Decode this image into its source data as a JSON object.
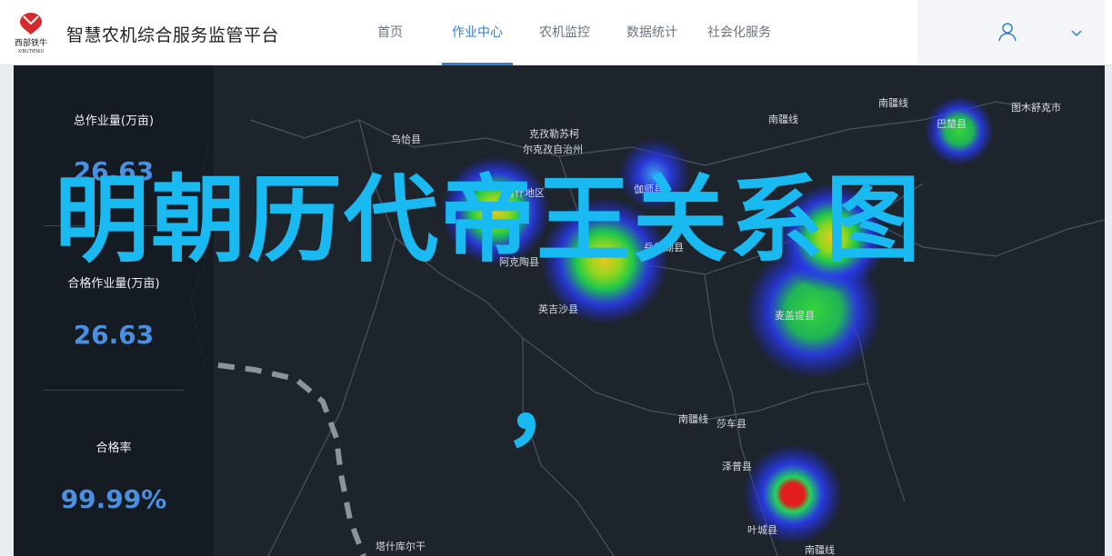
{
  "header": {
    "brand_text": "智慧农机综合服务监管平台",
    "logo_line1": "西部铁牛",
    "logo_line2": "XIBUTIENIU",
    "nav": [
      {
        "label": "首页",
        "active": false
      },
      {
        "label": "作业中心",
        "active": true
      },
      {
        "label": "农机监控",
        "active": false
      },
      {
        "label": "数据统计",
        "active": false
      },
      {
        "label": "社会化服务",
        "active": false
      }
    ]
  },
  "stats": [
    {
      "title": "总作业量(万亩)",
      "value": "26.63"
    },
    {
      "title": "合格作业量(万亩)",
      "value": "26.63"
    },
    {
      "title": "合格率",
      "value": "99.99%"
    }
  ],
  "map_labels": [
    "乌恰县",
    "克孜勒苏柯",
    "尔克孜自治州",
    "喀什地区",
    "伽师县",
    "岳普湖县",
    "阿克陶县",
    "英吉沙县",
    "南疆线",
    "南疆线",
    "图木舒克市",
    "巴楚县",
    "麦盖提县",
    "南疆线",
    "莎车县",
    "泽普县",
    "叶城县",
    "塔什库尔干",
    "南疆线"
  ],
  "overlay": {
    "text": "明朝历代帝王关系图",
    "comma": "，"
  },
  "colors": {
    "accent": "#2e7fd8",
    "stat_value": "#4a90e2",
    "overlay": "#19b9f2",
    "map_bg": "#1c2128"
  }
}
